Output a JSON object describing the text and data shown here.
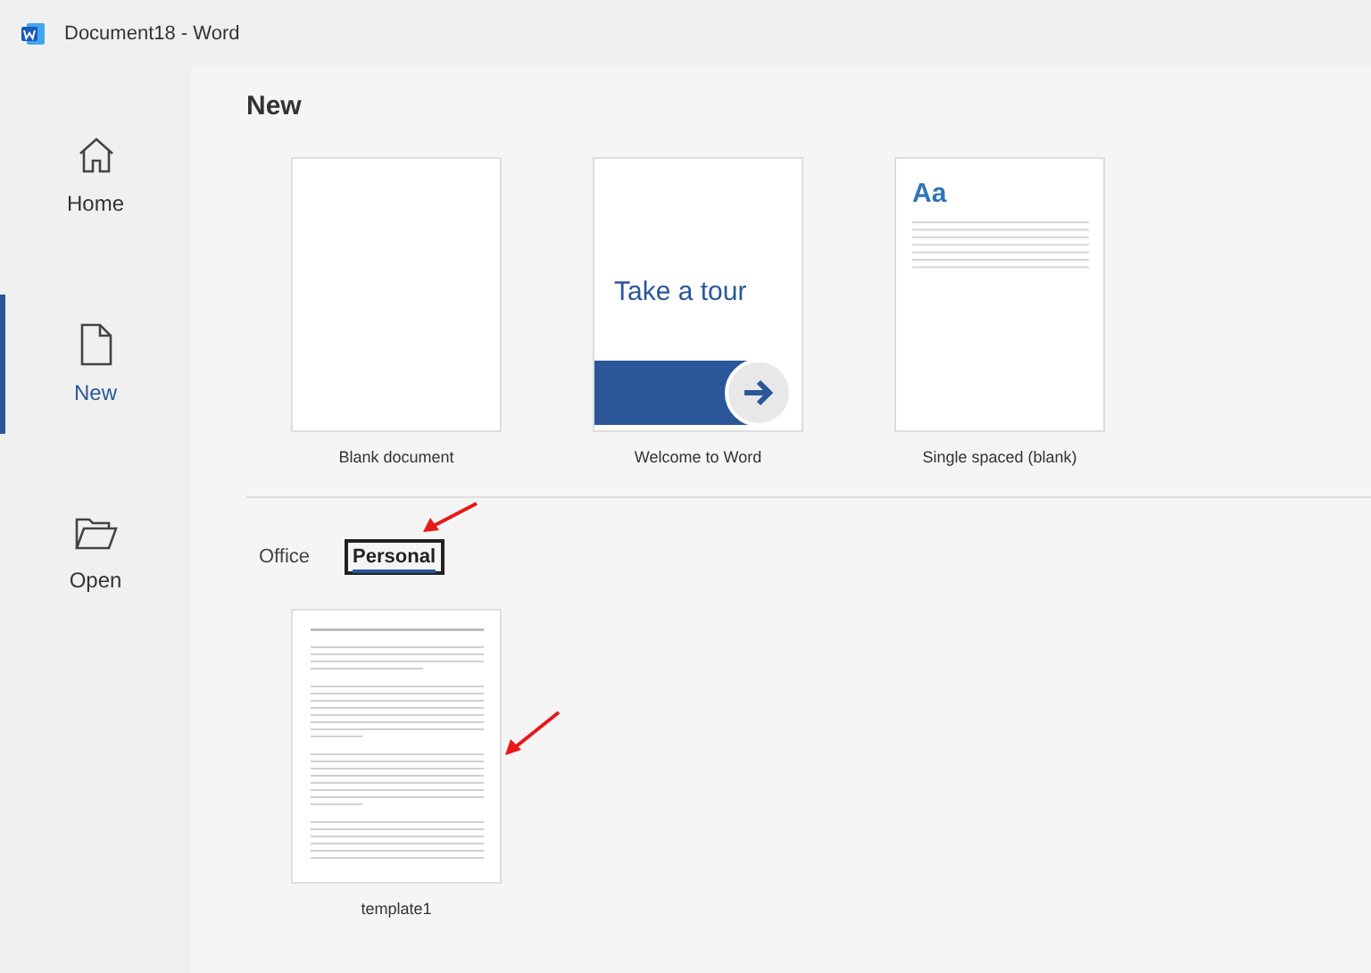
{
  "window": {
    "title": "Document18  -  Word"
  },
  "nav": [
    {
      "label": "Home",
      "kind": "home",
      "selected": false
    },
    {
      "label": "New",
      "kind": "new",
      "selected": true
    },
    {
      "label": "Open",
      "kind": "open",
      "selected": false
    }
  ],
  "heading": "New",
  "templates": [
    {
      "kind": "blank",
      "label": "Blank document"
    },
    {
      "kind": "tour",
      "label": "Welcome to Word",
      "thumb_text": "Take a tour"
    },
    {
      "kind": "lines",
      "label": "Single spaced (blank)",
      "thumb_text": "Aa"
    }
  ],
  "tabs": [
    {
      "label": "Office",
      "selected": false
    },
    {
      "label": "Personal",
      "selected": true
    }
  ],
  "personal_templates": [
    {
      "kind": "document",
      "label": "template1"
    }
  ]
}
